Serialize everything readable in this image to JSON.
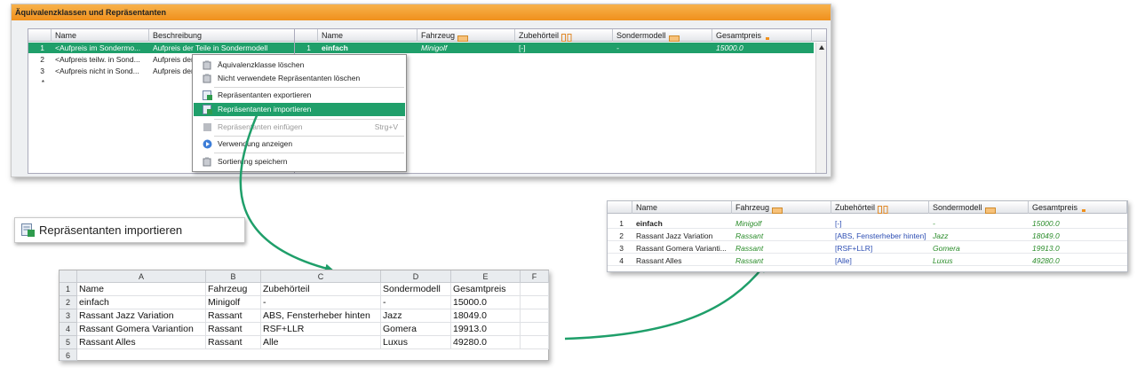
{
  "panel": {
    "title": "Äquivalenzklassen und Repräsentanten",
    "left_grid": {
      "columns": [
        "Name",
        "Beschreibung"
      ],
      "rows": [
        {
          "num": "1",
          "name": "<Aufpreis im Sondermo...",
          "desc": "Aufpreis der Teile in Sondermodell"
        },
        {
          "num": "2",
          "name": "<Aufpreis teilw. in Sond...",
          "desc": "Aufpreis der"
        },
        {
          "num": "3",
          "name": "<Aufpreis nicht in Sond...",
          "desc": "Aufpreis der"
        },
        {
          "num": "*",
          "name": "",
          "desc": ""
        }
      ]
    },
    "right_grid": {
      "columns": [
        "Name",
        "Fahrzeug",
        "Zubehörteil",
        "Sondermodell",
        "Gesamtpreis"
      ],
      "rows": [
        {
          "num": "1",
          "name": "einfach",
          "fahrzeug": "Minigolf",
          "zubehoer": "[-]",
          "sondermodell": "-",
          "preis": "15000.0"
        }
      ]
    }
  },
  "context_menu": {
    "items": [
      {
        "label": "Äquivalenzklasse löschen",
        "icon": "delete-class-icon"
      },
      {
        "label": "Nicht verwendete Repräsentanten löschen",
        "icon": "delete-unused-icon"
      },
      {
        "label": "Repräsentanten exportieren",
        "icon": "export-icon"
      },
      {
        "label": "Repräsentanten importieren",
        "icon": "import-icon"
      },
      {
        "label": "Repräsentanten einfügen",
        "icon": "paste-icon",
        "shortcut": "Strg+V"
      },
      {
        "label": "Verwendung anzeigen",
        "icon": "usage-icon"
      },
      {
        "label": "Sortierung speichern",
        "icon": "save-sort-icon"
      }
    ]
  },
  "callout": {
    "label": "Repräsentanten importieren",
    "icon": "import-icon"
  },
  "spreadsheet": {
    "col_headers": [
      "A",
      "B",
      "C",
      "D",
      "E",
      "F"
    ],
    "rows": [
      {
        "num": "1",
        "cells": [
          "Name",
          "Fahrzeug",
          "Zubehörteil",
          "Sondermodell",
          "Gesamtpreis",
          ""
        ]
      },
      {
        "num": "2",
        "cells": [
          "einfach",
          "Minigolf",
          "-",
          "-",
          "15000.0",
          ""
        ]
      },
      {
        "num": "3",
        "cells": [
          "Rassant Jazz Variation",
          "Rassant",
          "ABS, Fensterheber hinten",
          "Jazz",
          "18049.0",
          ""
        ]
      },
      {
        "num": "4",
        "cells": [
          "Rassant Gomera Variantion",
          "Rassant",
          "RSF+LLR",
          "Gomera",
          "19913.0",
          ""
        ]
      },
      {
        "num": "5",
        "cells": [
          "Rassant Alles",
          "Rassant",
          "Alle",
          "Luxus",
          "49280.0",
          ""
        ]
      },
      {
        "num": "6",
        "cells": [
          "",
          "",
          "",
          "",
          "",
          ""
        ]
      }
    ]
  },
  "result_grid": {
    "columns": [
      "Name",
      "Fahrzeug",
      "Zubehörteil",
      "Sondermodell",
      "Gesamtpreis"
    ],
    "rows": [
      {
        "num": "1",
        "name": "einfach",
        "fahrzeug": "Minigolf",
        "zubehoer": "[-]",
        "sondermodell": "-",
        "preis": "15000.0"
      },
      {
        "num": "2",
        "name": "Rassant Jazz Variation",
        "fahrzeug": "Rassant",
        "zubehoer": "[ABS, Fensterheber hinten]",
        "sondermodell": "Jazz",
        "preis": "18049.0"
      },
      {
        "num": "3",
        "name": "Rassant Gomera Varianti...",
        "fahrzeug": "Rassant",
        "zubehoer": "[RSF+LLR]",
        "sondermodell": "Gomera",
        "preis": "19913.0"
      },
      {
        "num": "4",
        "name": "Rassant Alles",
        "fahrzeug": "Rassant",
        "zubehoer": "[Alle]",
        "sondermodell": "Luxus",
        "preis": "49280.0"
      }
    ]
  },
  "colors": {
    "accent": "#1f9f6a",
    "title_bar": "#f0901c",
    "arrow": "#1f9f6a"
  }
}
